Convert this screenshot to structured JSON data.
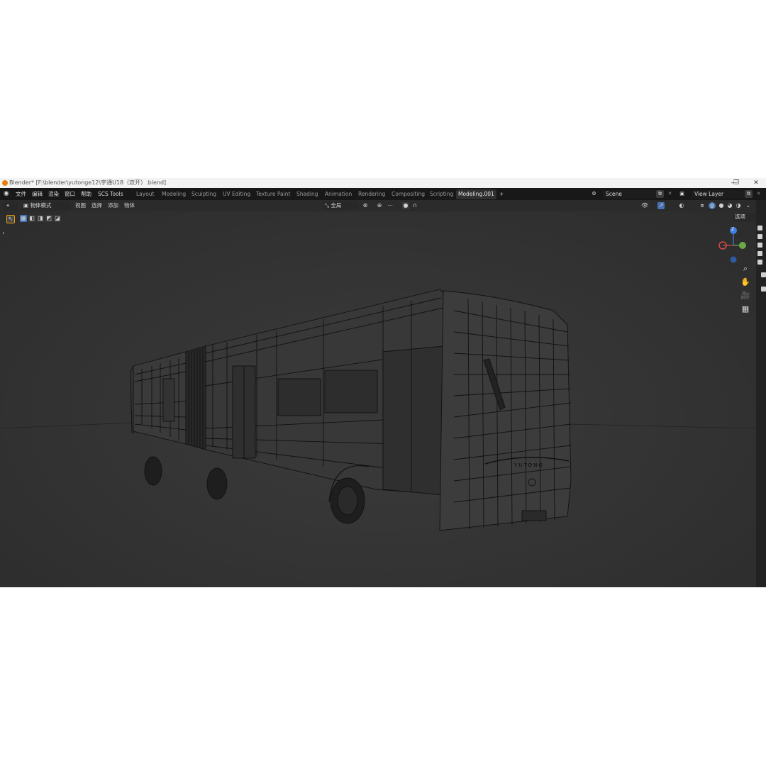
{
  "window": {
    "title": "Blender* [F:\\blender\\yutonge12\\宇通U18（双开）.blend]",
    "minimize_glyph": "—",
    "maximize_glyph": "❐",
    "close_glyph": "✕"
  },
  "menu": {
    "items": [
      "文件",
      "编辑",
      "渲染",
      "窗口",
      "帮助",
      "SCS Tools"
    ]
  },
  "workspaces": {
    "tabs": [
      "Layout",
      "Modeling",
      "Sculpting",
      "UV Editing",
      "Texture Paint",
      "Shading",
      "Animation",
      "Rendering",
      "Compositing",
      "Scripting",
      "Modeling.001"
    ],
    "active": "Modeling.001",
    "add_glyph": "+"
  },
  "scene": {
    "label": "Scene",
    "view_layer": "View Layer"
  },
  "viewport_header": {
    "mode": "物体模式",
    "menus": [
      "视图",
      "选择",
      "添加",
      "物体"
    ],
    "transform_orientation": "全局",
    "options_label": "选项"
  },
  "gizmo": {
    "z": "Z",
    "x": "X",
    "y": "Y"
  },
  "model": {
    "brand_text": "YUTONG"
  },
  "colors": {
    "accent_blue": "#4772b3",
    "gizmo_x": "#d84a4a",
    "gizmo_y": "#6ba84a",
    "gizmo_z": "#3f7fe0",
    "wire": "#0e0e0e"
  }
}
